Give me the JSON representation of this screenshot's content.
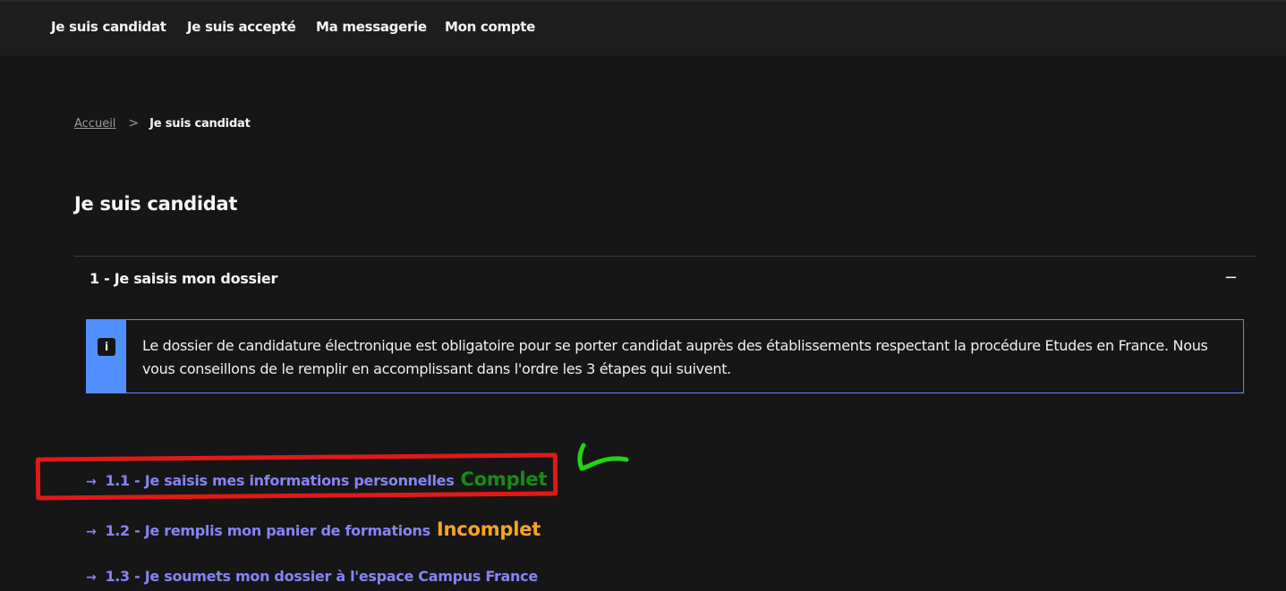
{
  "topnav": {
    "items": [
      "Je suis candidat",
      "Je suis accepté",
      "Ma messagerie",
      "Mon compte"
    ]
  },
  "breadcrumb": {
    "home": "Accueil",
    "separator": ">",
    "current": "Je suis candidat"
  },
  "page": {
    "title": "Je suis candidat"
  },
  "accordion": {
    "title": "1 - Je saisis mon dossier",
    "toggle": "−"
  },
  "notice": {
    "icon": "info-icon",
    "icon_glyph": "i",
    "text": "Le dossier de candidature électronique est obligatoire pour se porter candidat auprès des établissements respectant la procédure Etudes en France. Nous vous conseillons de le remplir en accomplissant dans l'ordre les 3 étapes qui suivent."
  },
  "steps": [
    {
      "arrow": "→",
      "label": "1.1 - Je saisis mes informations personnelles",
      "status": "Complet",
      "status_color": "#1a8a1a"
    },
    {
      "arrow": "→",
      "label": "1.2 - Je remplis mon panier de formations",
      "status": "Incomplet",
      "status_color": "#f5a524"
    },
    {
      "arrow": "→",
      "label": "1.3 - Je soumets mon dossier à l'espace Campus France",
      "status": "",
      "status_color": ""
    }
  ],
  "colors": {
    "link": "#8585f6",
    "info_blue": "#518fff",
    "annotation_red": "#e01919",
    "annotation_green": "#22d414",
    "background": "#161616"
  }
}
